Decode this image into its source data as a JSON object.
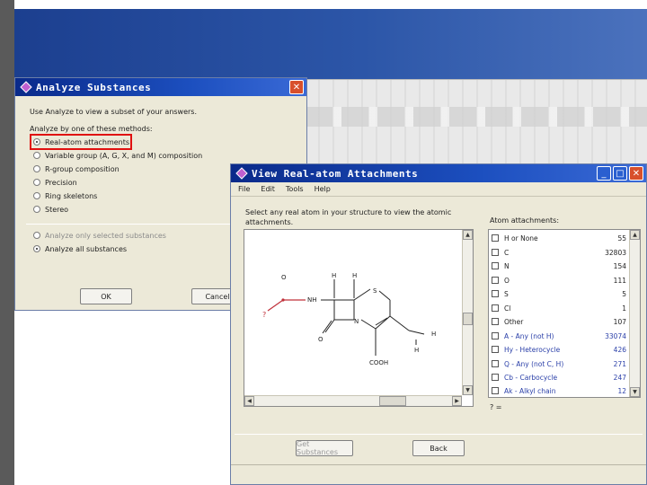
{
  "analyze_dialog": {
    "title": "Analyze Substances",
    "intro": "Use Analyze to view a subset of your answers.",
    "method_prompt": "Analyze by one of these methods:",
    "methods": [
      "Real-atom attachments",
      "Variable group (A, G, X, and M) composition",
      "R-group composition",
      "Precision",
      "Ring skeletons",
      "Stereo"
    ],
    "selected_method": "Real-atom attachments",
    "scope_options": [
      {
        "label": "Analyze only selected substances",
        "enabled": false,
        "selected": false
      },
      {
        "label": "Analyze all substances",
        "enabled": true,
        "selected": true
      }
    ],
    "ok_label": "OK",
    "cancel_label": "Cancel"
  },
  "view_dialog": {
    "title": "View Real-atom Attachments",
    "menu": [
      "File",
      "Edit",
      "Tools",
      "Help"
    ],
    "instruction": "Select any real atom in your structure to view the atomic attachments.",
    "list_header": "Atom attachments:",
    "structure_labels": [
      "O",
      "H",
      "H",
      "S",
      "NH",
      "N",
      "O",
      "COOH",
      "H",
      "H",
      "?"
    ],
    "attachments": [
      {
        "label": "H or None",
        "count": "55",
        "generic": false
      },
      {
        "label": "C",
        "count": "32803",
        "generic": false
      },
      {
        "label": "N",
        "count": "154",
        "generic": false
      },
      {
        "label": "O",
        "count": "111",
        "generic": false
      },
      {
        "label": "S",
        "count": "5",
        "generic": false
      },
      {
        "label": "Cl",
        "count": "1",
        "generic": false
      },
      {
        "label": "Other",
        "count": "107",
        "generic": false
      },
      {
        "label": "A - Any (not H)",
        "count": "33074",
        "generic": true
      },
      {
        "label": "Hy - Heterocycle",
        "count": "426",
        "generic": true
      },
      {
        "label": "Q - Any (not C, H)",
        "count": "271",
        "generic": true
      },
      {
        "label": "Cb - Carbocycle",
        "count": "247",
        "generic": true
      },
      {
        "label": "Ak - Alkyl chain",
        "count": "12",
        "generic": true
      }
    ],
    "list_footer": "? =",
    "get_substances_label": "Get Substances",
    "back_label": "Back"
  },
  "colors": {
    "title_bar": "#1c4fbf",
    "highlight": "#e01010",
    "attachment_bond": "#c0303a",
    "generic_text": "#2a3fa8"
  },
  "icons": [
    "app-icon",
    "close-icon",
    "minimize-icon",
    "maximize-icon"
  ]
}
